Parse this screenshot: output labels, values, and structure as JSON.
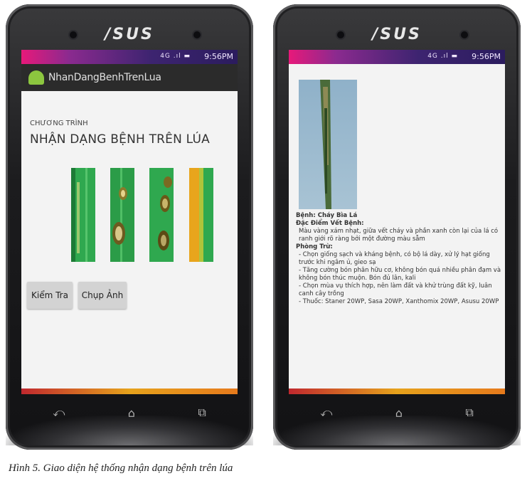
{
  "phone_brand": "/SUS",
  "status_time": "9:56PM",
  "status_icons": "4G .ıl ▬",
  "left_screen": {
    "app_title": "NhanDangBenhTrenLua",
    "program_label": "CHƯƠNG TRÌNH",
    "program_title": "NHẬN DẠNG BỆNH TRÊN LÚA",
    "check_button": "Kiểm Tra",
    "capture_button": "Chụp Ảnh"
  },
  "right_screen": {
    "disease": "Bệnh: Cháy Bìa Lá",
    "features_heading": "Đặc Điểm Vết Bệnh:",
    "features_text": "Màu vàng xám nhạt, giữa vết cháy và phần xanh còn lại của lá có ranh giới rõ ràng bởi một đường màu sẫm",
    "prevention_heading": "Phòng Trừ:",
    "prevention_items": [
      "- Chọn giống sạch và kháng bệnh, có bộ lá dày, xử lý hạt giống trước khi ngâm ủ, gieo sạ",
      "- Tăng cường bón phân hữu cơ, không bón quá nhiều phân đạm và không bón thúc muộn. Bón đủ lân, kali",
      "- Chọn mùa vụ thích hợp, nên làm đất và khử trùng đất kỹ, luân canh cây trồng",
      "- Thuốc: Staner 20WP, Sasa 20WP, Xanthomix 20WP, Asusu 20WP"
    ]
  },
  "nav_icons": [
    "back-icon",
    "home-icon",
    "recent-apps-icon"
  ],
  "nav_glyphs": {
    "back": "⤺",
    "home": "⌂",
    "recent": "⧉"
  },
  "caption": "Hình 5. Giao diện hệ thống nhận dạng bệnh trên lúa",
  "colors": {
    "status_gradient_start": "#e7197a",
    "status_gradient_end": "#2b1c5e",
    "leaf_green": "#2fa84f",
    "android_green": "#8cc63f"
  }
}
